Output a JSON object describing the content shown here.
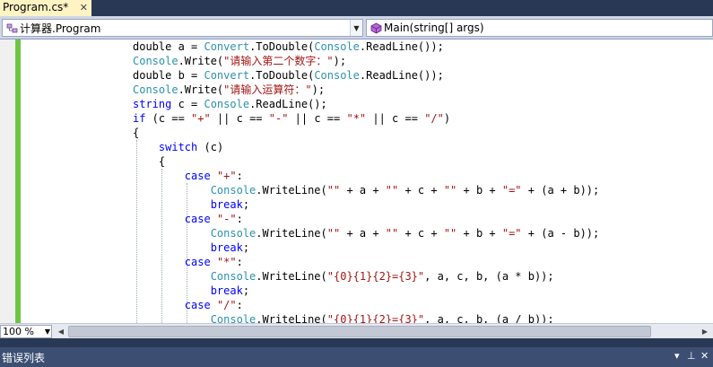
{
  "tab": {
    "title": "Program.cs*",
    "close_glyph": "✕"
  },
  "nav": {
    "class_combo": "计算器.Program",
    "member_combo": "Main(string[] args)"
  },
  "code": {
    "lines": [
      [
        [
          "",
          "double a = "
        ],
        [
          "ty",
          "Convert"
        ],
        [
          "",
          ".ToDouble("
        ],
        [
          "ty",
          "Console"
        ],
        [
          "",
          ".ReadLine());"
        ]
      ],
      [
        [
          "ty",
          "Console"
        ],
        [
          "",
          ".Write("
        ],
        [
          "st",
          "\"请输入第二个数字：\""
        ],
        [
          "",
          ");"
        ]
      ],
      [
        [
          "",
          "double b = "
        ],
        [
          "ty",
          "Convert"
        ],
        [
          "",
          ".ToDouble("
        ],
        [
          "ty",
          "Console"
        ],
        [
          "",
          ".ReadLine());"
        ]
      ],
      [
        [
          "ty",
          "Console"
        ],
        [
          "",
          ".Write("
        ],
        [
          "st",
          "\"请输入运算符：\""
        ],
        [
          "",
          ");"
        ]
      ],
      [
        [
          "kw",
          "string"
        ],
        [
          "",
          " c = "
        ],
        [
          "ty",
          "Console"
        ],
        [
          "",
          ".ReadLine();"
        ]
      ],
      [
        [
          "kw",
          "if"
        ],
        [
          "",
          " (c == "
        ],
        [
          "st",
          "\"+\""
        ],
        [
          "",
          " || c == "
        ],
        [
          "st",
          "\"-\""
        ],
        [
          "",
          " || c == "
        ],
        [
          "st",
          "\"*\""
        ],
        [
          "",
          " || c == "
        ],
        [
          "st",
          "\"/\""
        ],
        [
          "",
          ")"
        ]
      ],
      [
        [
          "",
          "{"
        ]
      ],
      [
        [
          "",
          "    "
        ],
        [
          "kw",
          "switch"
        ],
        [
          "",
          " (c)"
        ]
      ],
      [
        [
          "",
          "    {"
        ]
      ],
      [
        [
          "",
          "        "
        ],
        [
          "kw",
          "case"
        ],
        [
          "",
          " "
        ],
        [
          "st",
          "\"+\""
        ],
        [
          "",
          ":"
        ]
      ],
      [
        [
          "",
          "            "
        ],
        [
          "ty",
          "Console"
        ],
        [
          "",
          ".WriteLine("
        ],
        [
          "st",
          "\"\""
        ],
        [
          "",
          " + a + "
        ],
        [
          "st",
          "\"\""
        ],
        [
          "",
          " + c + "
        ],
        [
          "st",
          "\"\""
        ],
        [
          "",
          " + b + "
        ],
        [
          "st",
          "\"=\""
        ],
        [
          "",
          " + (a + b));"
        ]
      ],
      [
        [
          "",
          "            "
        ],
        [
          "kw",
          "break"
        ],
        [
          "",
          ";"
        ]
      ],
      [
        [
          "",
          "        "
        ],
        [
          "kw",
          "case"
        ],
        [
          "",
          " "
        ],
        [
          "st",
          "\"-\""
        ],
        [
          "",
          ":"
        ]
      ],
      [
        [
          "",
          "            "
        ],
        [
          "ty",
          "Console"
        ],
        [
          "",
          ".WriteLine("
        ],
        [
          "st",
          "\"\""
        ],
        [
          "",
          " + a + "
        ],
        [
          "st",
          "\"\""
        ],
        [
          "",
          " + c + "
        ],
        [
          "st",
          "\"\""
        ],
        [
          "",
          " + b + "
        ],
        [
          "st",
          "\"=\""
        ],
        [
          "",
          " + (a - b));"
        ]
      ],
      [
        [
          "",
          "            "
        ],
        [
          "kw",
          "break"
        ],
        [
          "",
          ";"
        ]
      ],
      [
        [
          "",
          "        "
        ],
        [
          "kw",
          "case"
        ],
        [
          "",
          " "
        ],
        [
          "st",
          "\"*\""
        ],
        [
          "",
          ":"
        ]
      ],
      [
        [
          "",
          "            "
        ],
        [
          "ty",
          "Console"
        ],
        [
          "",
          ".WriteLine("
        ],
        [
          "st",
          "\"{0}{1}{2}={3}\""
        ],
        [
          "",
          ", a, c, b, (a * b));"
        ]
      ],
      [
        [
          "",
          "            "
        ],
        [
          "kw",
          "break"
        ],
        [
          "",
          ";"
        ]
      ],
      [
        [
          "",
          "        "
        ],
        [
          "kw",
          "case"
        ],
        [
          "",
          " "
        ],
        [
          "st",
          "\"/\""
        ],
        [
          "",
          ":"
        ]
      ],
      [
        [
          "",
          "            "
        ],
        [
          "ty",
          "Console"
        ],
        [
          "",
          ".WriteLine("
        ],
        [
          "st",
          "\"{0}{1}{2}={3}\""
        ],
        [
          "",
          ", a, c, b, (a / b));"
        ]
      ]
    ]
  },
  "zoom": {
    "value": "100 %"
  },
  "panel": {
    "title": "错误列表",
    "dropdown_glyph": "▾",
    "pin_glyph": "⊥",
    "close_glyph": "✕"
  },
  "colors": {
    "keyword": "#0000ff",
    "type": "#2b91af",
    "string": "#a31515",
    "change_bar": "#6cc644"
  }
}
